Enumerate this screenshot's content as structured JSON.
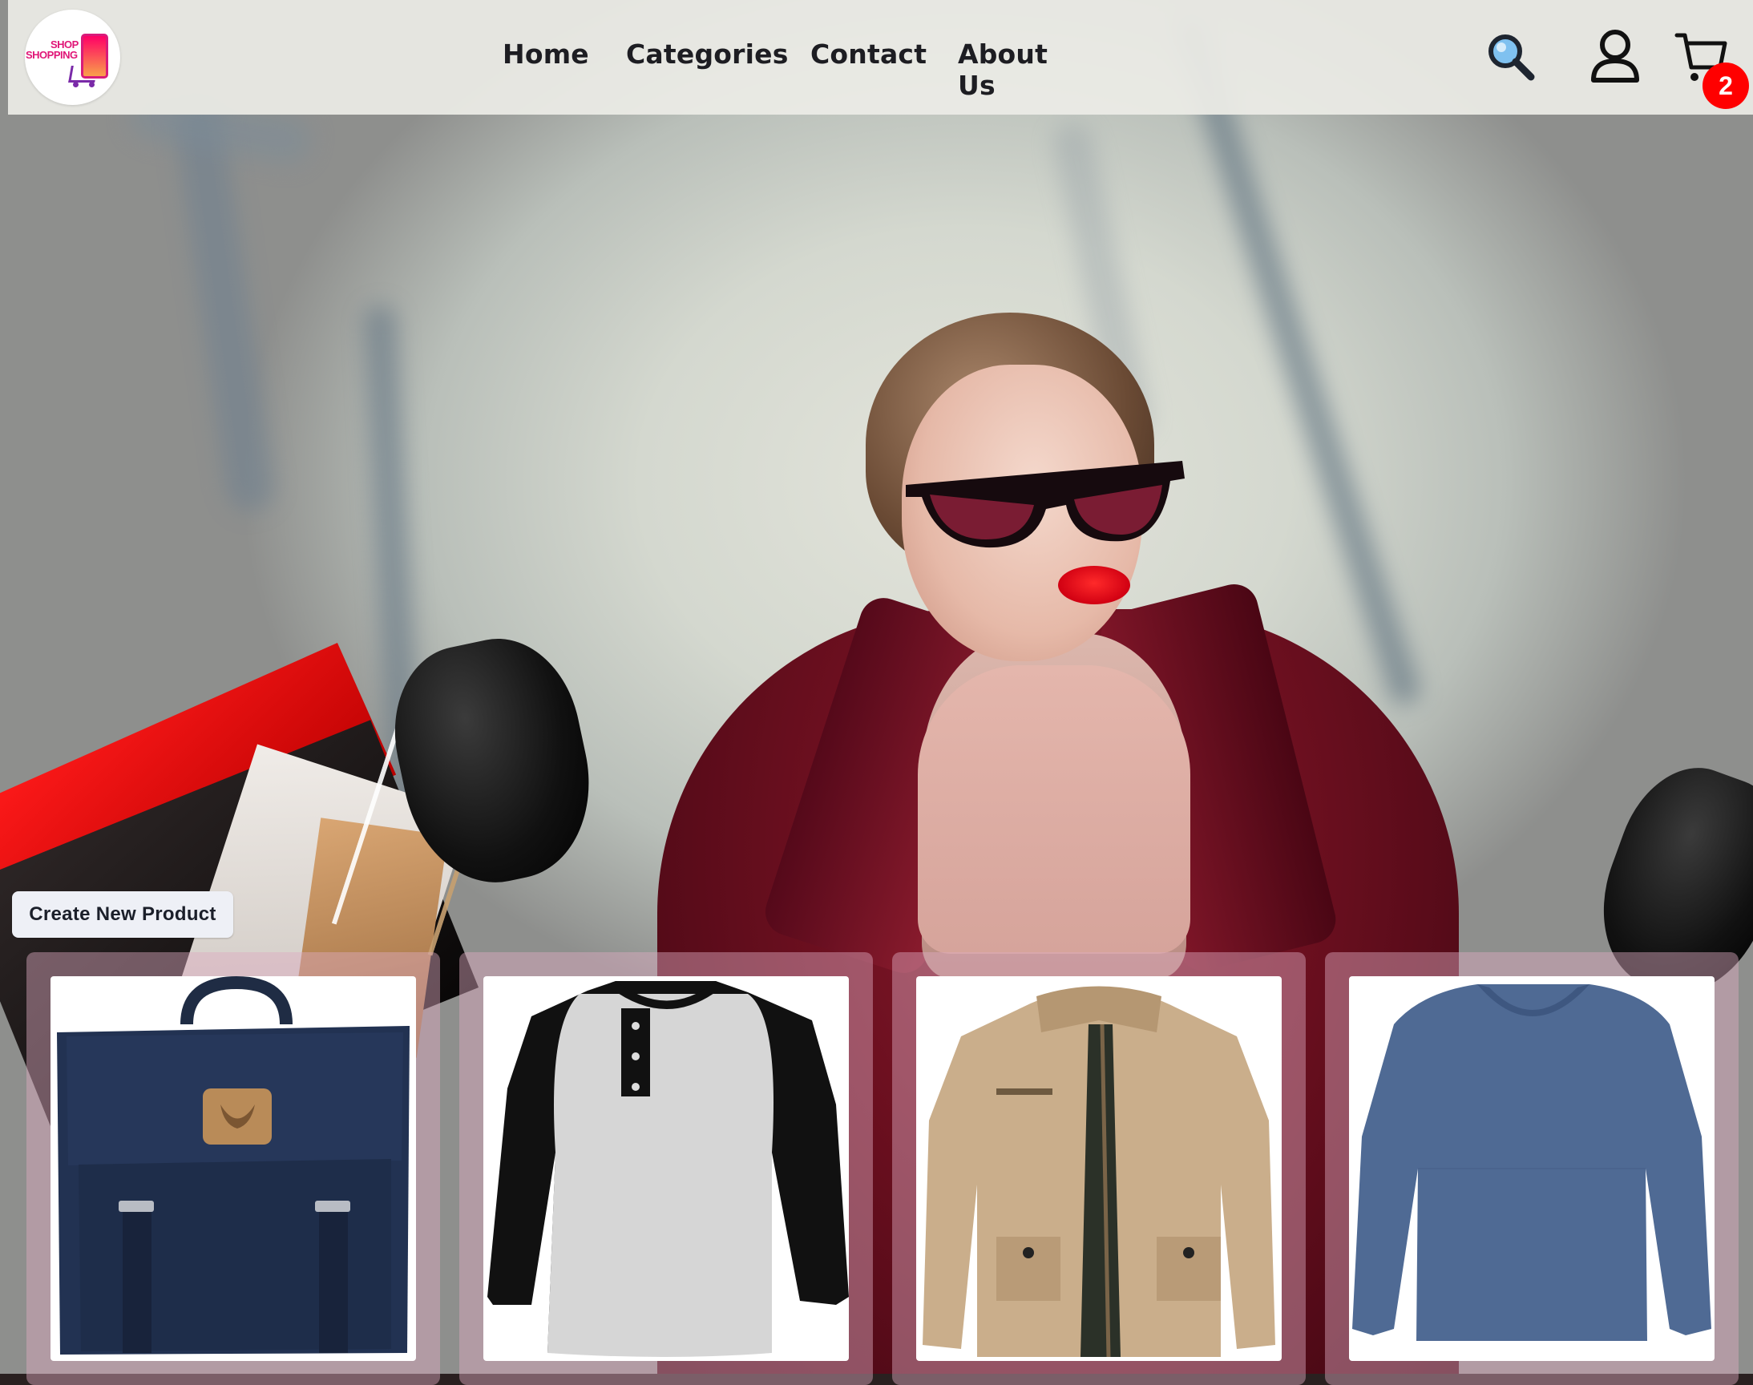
{
  "brand": {
    "logo_line1": "SHOP",
    "logo_line2": "SHOPPING"
  },
  "nav": {
    "home": "Home",
    "categories": "Categories",
    "contact": "Contact",
    "about": "About Us"
  },
  "header_icons": {
    "search": "search-icon",
    "account": "user-icon",
    "cart": "cart-icon"
  },
  "cart": {
    "count": "2"
  },
  "actions": {
    "create_product": "Create New Product"
  },
  "products": [
    {
      "name": "navy-backpack",
      "icon": "backpack"
    },
    {
      "name": "raglan-henley-shirt",
      "icon": "shirt"
    },
    {
      "name": "khaki-jacket",
      "icon": "jacket"
    },
    {
      "name": "blue-long-sleeve-shirt",
      "icon": "shirt"
    }
  ],
  "colors": {
    "badge": "#ff0000",
    "nav_text": "#1d1d22",
    "header_bg": "#ecece6",
    "card_tint": "#deaac0"
  }
}
